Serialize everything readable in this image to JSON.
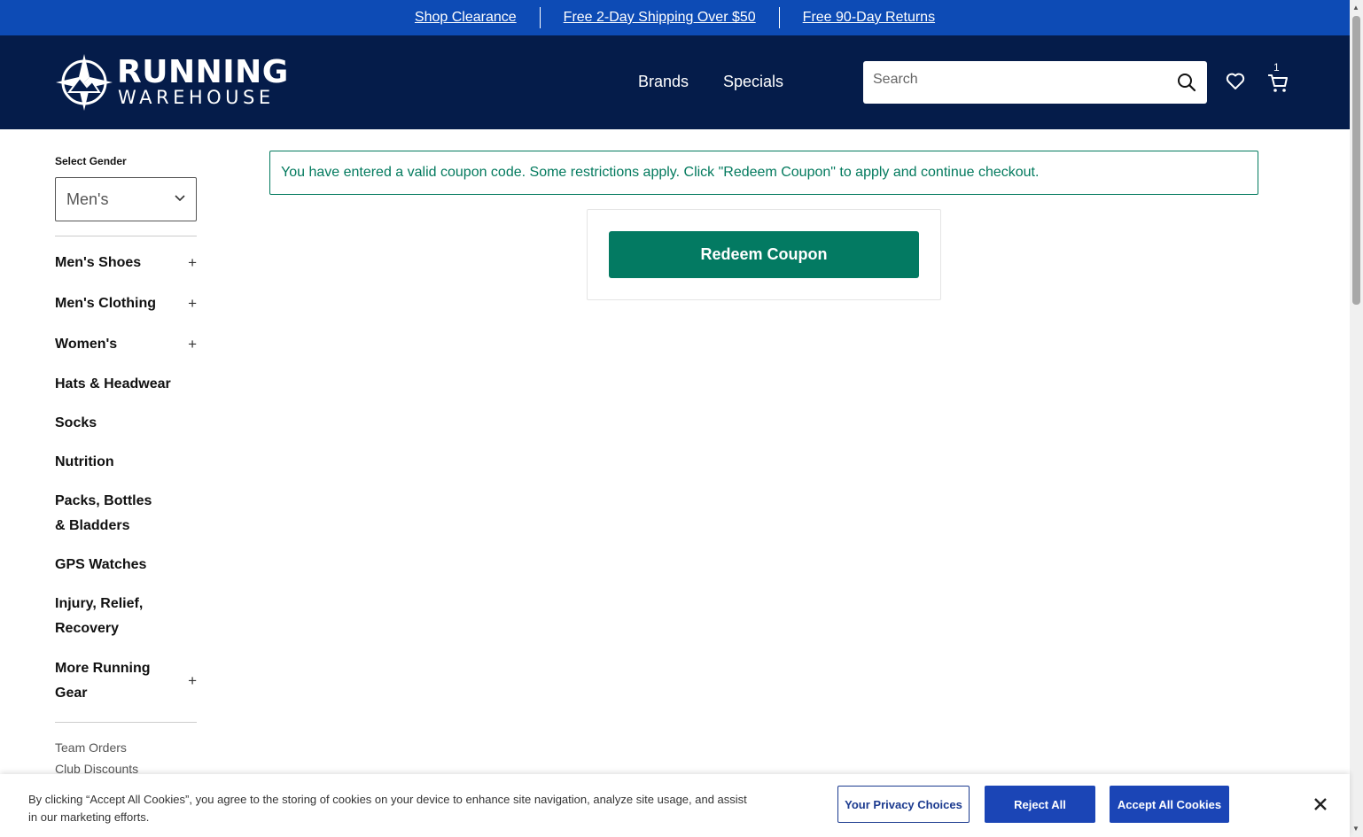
{
  "promo_bar": {
    "link1": "Shop Clearance",
    "link2": "Free 2-Day Shipping Over $50",
    "link3": "Free 90-Day Returns"
  },
  "header": {
    "logo_line1": "RUNNING",
    "logo_line2": "WAREHOUSE",
    "nav": [
      "Brands",
      "Specials"
    ],
    "search_placeholder": "Search",
    "cart_count": "1"
  },
  "sidebar": {
    "gender_label": "Select Gender",
    "gender_value": "Men's",
    "categories": [
      {
        "label": "Men's Shoes",
        "expandable": true
      },
      {
        "label": "Men's Clothing",
        "expandable": true
      },
      {
        "label": "Women's",
        "expandable": true
      },
      {
        "label": "Hats & Headwear",
        "expandable": false
      },
      {
        "label": "Socks",
        "expandable": false
      },
      {
        "label": "Nutrition",
        "expandable": false
      },
      {
        "label": "Packs, Bottles & Bladders",
        "expandable": false
      },
      {
        "label": "GPS Watches",
        "expandable": false
      },
      {
        "label": "Injury, Relief, Recovery",
        "expandable": false
      },
      {
        "label": "More Running Gear",
        "expandable": true
      }
    ],
    "expand_symbol": "+",
    "links": [
      "Team Orders",
      "Club Discounts"
    ]
  },
  "main": {
    "alert_text": "You have entered a valid coupon code. Some restrictions apply. Click \"Redeem Coupon\" to apply and continue checkout.",
    "redeem_label": "Redeem Coupon"
  },
  "cookie_banner": {
    "text": "By clicking “Accept All Cookies”, you agree to the storing of cookies on your device to enhance site navigation, analyze site usage, and assist in our marketing efforts.",
    "privacy_label": "Your Privacy Choices",
    "reject_label": "Reject All",
    "accept_label": "Accept All Cookies"
  },
  "colors": {
    "promo_bg": "#0d4bb5",
    "header_bg": "#051c4a",
    "accent_green": "#037a62",
    "cookie_button": "#1b45b6"
  }
}
